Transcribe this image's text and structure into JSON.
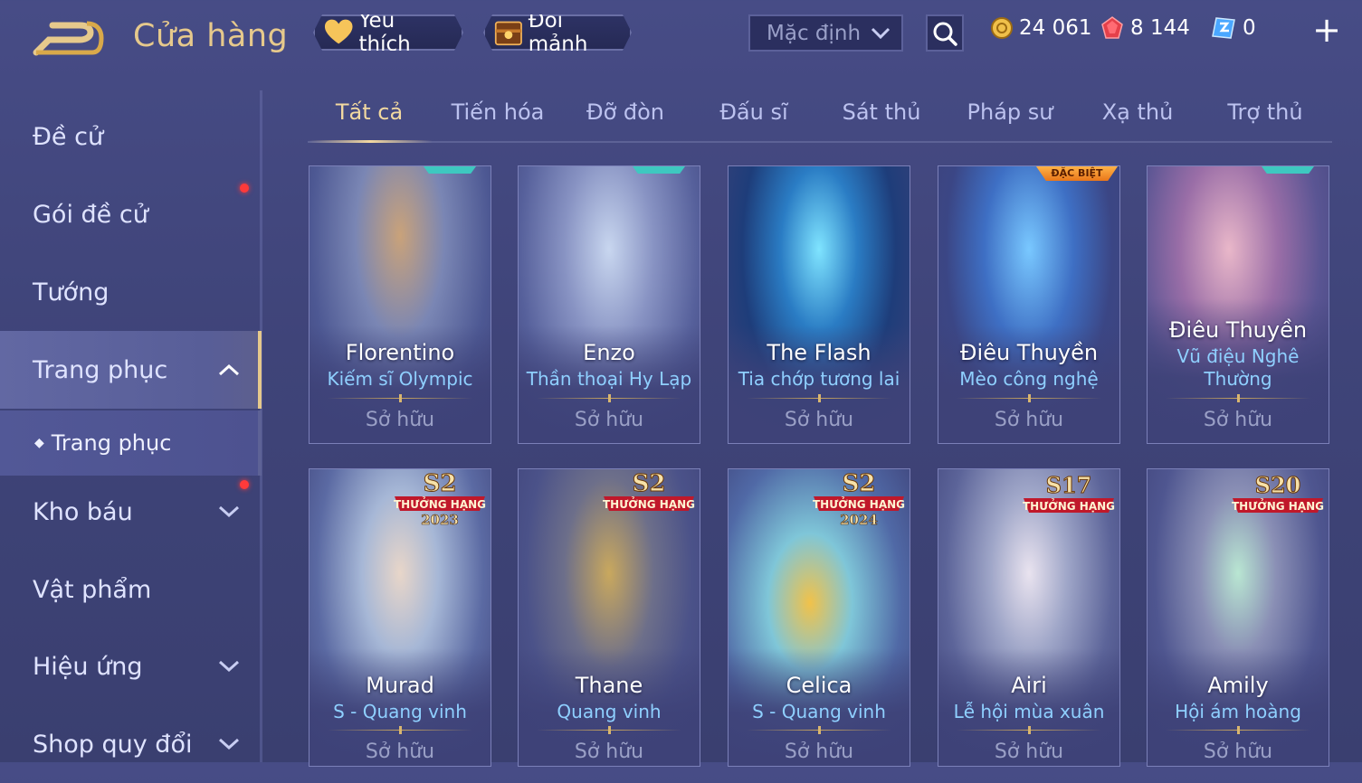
{
  "header": {
    "title": "Cửa hàng",
    "favorite_label": "Yêu thích",
    "exchange_label": "Đổi mảnh",
    "sort_value": "Mặc định",
    "currencies": {
      "gold": "24 061",
      "ruby": "8 144",
      "voucher": "0"
    }
  },
  "sidebar": {
    "items": [
      {
        "label": "Đề cử"
      },
      {
        "label": "Gói đề cử"
      },
      {
        "label": "Tướng"
      },
      {
        "label": "Trang phục"
      },
      {
        "label": "Kho báu"
      },
      {
        "label": "Vật phẩm"
      },
      {
        "label": "Hiệu ứng"
      },
      {
        "label": "Shop quy đổi"
      }
    ],
    "sub_item": "Trang phục"
  },
  "tabs": [
    "Tất cả",
    "Tiến hóa",
    "Đỡ đòn",
    "Đấu sĩ",
    "Sát thủ",
    "Pháp sư",
    "Xạ thủ",
    "Trợ thủ"
  ],
  "cards": [
    {
      "hero": "Florentino",
      "skin": "Kiếm sĩ Olympic",
      "status": "Sở hữu"
    },
    {
      "hero": "Enzo",
      "skin": "Thần thoại Hy Lạp",
      "status": "Sở hữu"
    },
    {
      "hero": "The Flash",
      "skin": "Tia chớp tương lai",
      "status": "Sở hữu"
    },
    {
      "hero": "Điêu Thuyền",
      "skin": "Mèo công nghệ",
      "status": "Sở hữu",
      "tag": "ĐẶC BIỆT"
    },
    {
      "hero": "Điêu Thuyền",
      "skin": "Vũ điệu Nghê Thường",
      "status": "Sở hữu"
    },
    {
      "hero": "Murad",
      "skin": "S - Quang vinh",
      "status": "Sở hữu",
      "badge": {
        "season": "S2",
        "text": "THƯỞNG HẠNG",
        "year": "2023"
      }
    },
    {
      "hero": "Thane",
      "skin": "Quang vinh",
      "status": "Sở hữu",
      "badge": {
        "season": "S2",
        "text": "THƯỞNG HẠNG",
        "year": ""
      }
    },
    {
      "hero": "Celica",
      "skin": "S - Quang vinh",
      "status": "Sở hữu",
      "badge": {
        "season": "S2",
        "text": "THƯỞNG HẠNG",
        "year": "2024"
      }
    },
    {
      "hero": "Airi",
      "skin": "Lễ hội mùa xuân",
      "status": "Sở hữu",
      "badge": {
        "season": "S17",
        "text": "THƯỞNG HẠNG",
        "year": ""
      }
    },
    {
      "hero": "Amily",
      "skin": "Hội ám hoàng",
      "status": "Sở hữu",
      "badge": {
        "season": "S20",
        "text": "THƯỞNG HẠNG",
        "year": ""
      }
    }
  ],
  "colors": {
    "accent_gold": "#e6c98c",
    "skin_blue": "#8fd0ff",
    "notice_red": "#ff3a3a"
  }
}
